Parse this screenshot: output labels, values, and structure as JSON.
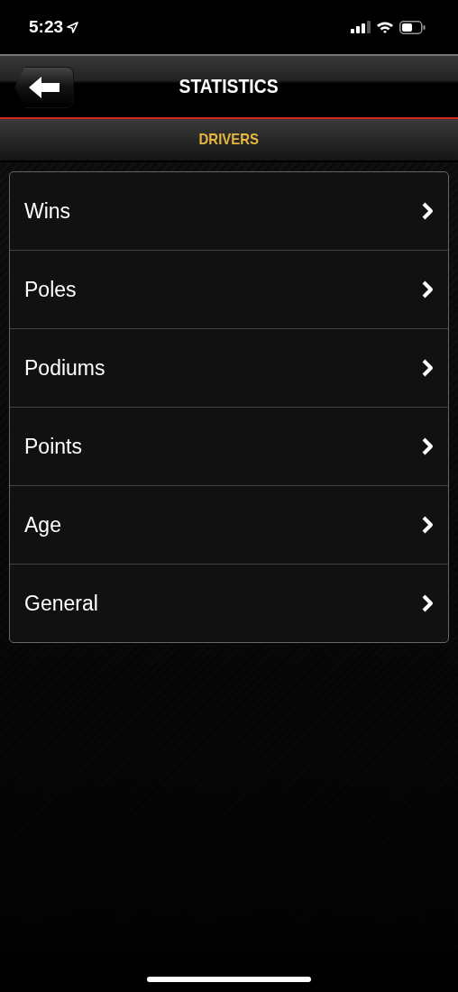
{
  "status_bar": {
    "time": "5:23"
  },
  "nav_bar": {
    "title": "STATISTICS"
  },
  "section_header": "DRIVERS",
  "menu_items": [
    {
      "label": "Wins"
    },
    {
      "label": "Poles"
    },
    {
      "label": "Podiums"
    },
    {
      "label": "Points"
    },
    {
      "label": "Age"
    },
    {
      "label": "General"
    }
  ]
}
